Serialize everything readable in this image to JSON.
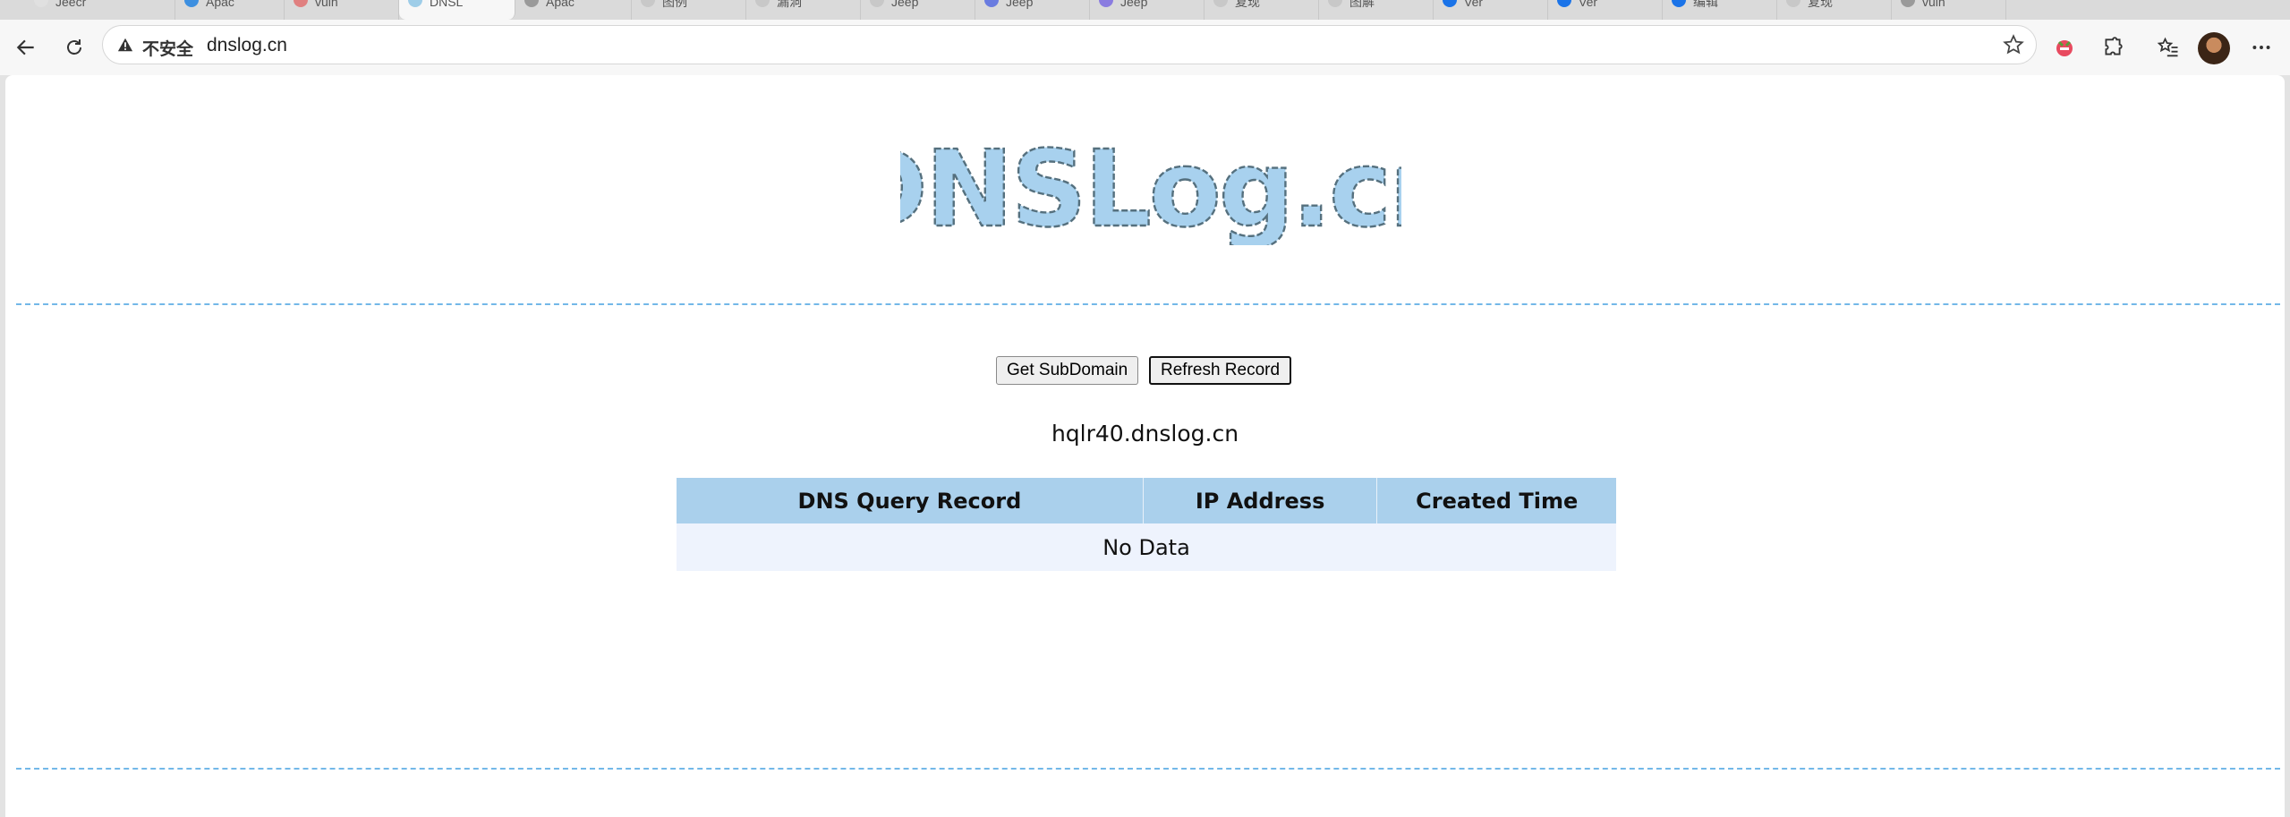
{
  "browser": {
    "tabs": [
      {
        "label": "Jeecr",
        "favicon_color": "#e0e0e0"
      },
      {
        "label": "Apac",
        "favicon_color": "#3d8fe0"
      },
      {
        "label": "vulh",
        "favicon_color": "#e08080"
      },
      {
        "label": "DNSL",
        "favicon_color": "#9ecde8"
      },
      {
        "label": "Apac",
        "favicon_color": "#9a9a9a"
      },
      {
        "label": "图例",
        "favicon_color": "#c8c8c8"
      },
      {
        "label": "漏洞",
        "favicon_color": "#c8c8c8"
      },
      {
        "label": "Jeep",
        "favicon_color": "#c8c8c8"
      },
      {
        "label": "Jeep",
        "favicon_color": "#6a7ce0"
      },
      {
        "label": "Jeep",
        "favicon_color": "#8a7ce0"
      },
      {
        "label": "复现",
        "favicon_color": "#c8c8c8"
      },
      {
        "label": "图解",
        "favicon_color": "#c8c8c8"
      },
      {
        "label": "Ver",
        "favicon_color": "#1a73e8"
      },
      {
        "label": "Ver",
        "favicon_color": "#1a73e8"
      },
      {
        "label": "编辑",
        "favicon_color": "#1a73e8"
      },
      {
        "label": "复现",
        "favicon_color": "#c8c8c8"
      },
      {
        "label": "vulh",
        "favicon_color": "#9a9a9a"
      }
    ],
    "security_label": "不安全",
    "url": "dnslog.cn",
    "icons": {
      "back": "back-arrow-icon",
      "reload": "reload-icon",
      "warning": "warning-icon",
      "favorite": "star-icon",
      "extension": "puzzle-icon",
      "favorites": "favorites-list-icon",
      "menu": "more-icon"
    }
  },
  "page": {
    "logo_text": "DNSLog.cn",
    "buttons": {
      "get_subdomain": "Get SubDomain",
      "refresh_record": "Refresh Record"
    },
    "subdomain": "hqlr40.dnslog.cn",
    "table": {
      "headers": [
        "DNS Query Record",
        "IP Address",
        "Created Time"
      ],
      "empty_text": "No Data"
    }
  },
  "colors": {
    "logo_fill": "#a8d1ee",
    "header_bg": "#aad0ec",
    "row_bg": "#eef3fd",
    "divider": "#73b8e8"
  }
}
